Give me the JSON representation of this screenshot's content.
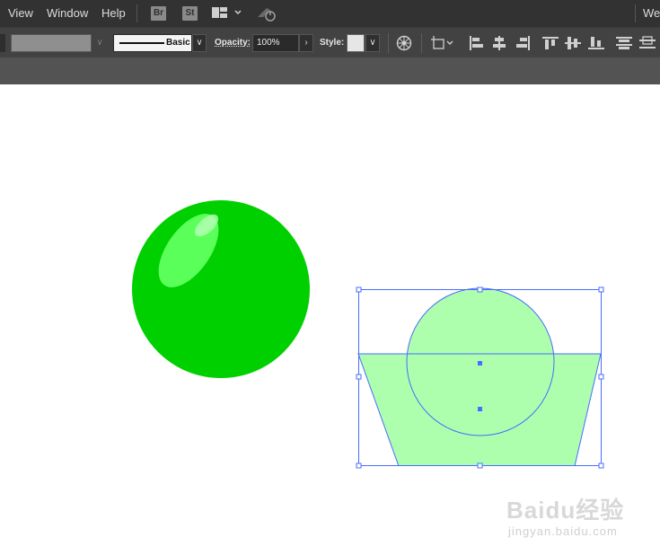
{
  "menubar": {
    "items": [
      "View",
      "Window",
      "Help"
    ],
    "badges": [
      "Br",
      "St"
    ],
    "workspace_label": "We"
  },
  "controlbar": {
    "brush_label": "Basic",
    "opacity_label": "Opacity:",
    "opacity_value": "100%",
    "style_label": "Style:"
  },
  "canvas": {
    "sphere_color": "#00d000",
    "highlight_color": "#5aff5a",
    "selected_fill": "#adffad",
    "selection_color": "#4a6cff"
  },
  "watermark": {
    "logo": "Baidu经验",
    "url": "jingyan.baidu.com"
  }
}
